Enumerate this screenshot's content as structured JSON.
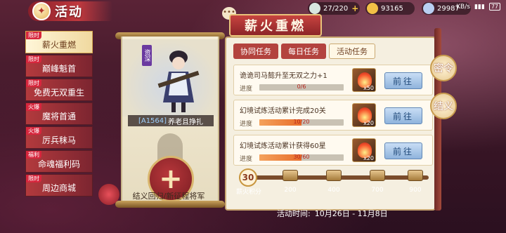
{
  "header": {
    "title": "活动",
    "resources": [
      {
        "name": "stamina",
        "value": "27/220",
        "color": "#d8e6e0"
      },
      {
        "name": "gold",
        "value": "93165",
        "color": "#f2c046"
      },
      {
        "name": "gem",
        "value": "29987",
        "color": "#b9cff2"
      }
    ],
    "status": {
      "net": "KB/s",
      "battery": "77"
    }
  },
  "menu": {
    "items": [
      {
        "tag": "限时",
        "label": "薪火重燃",
        "active": true
      },
      {
        "tag": "限时",
        "label": "巅峰魁首"
      },
      {
        "tag": "限时",
        "label": "免费无双重生"
      },
      {
        "tag": "火爆",
        "label": "魔将首通"
      },
      {
        "tag": "火爆",
        "label": "厉兵秣马"
      },
      {
        "tag": "福利",
        "label": "命魂福利码"
      },
      {
        "tag": "限时",
        "label": "周边商城"
      }
    ]
  },
  "scroll": {
    "rank": "资深",
    "hero_id": "[A1564]",
    "hero_name": "养老且挣扎",
    "caption": "结义回归/新征程将军"
  },
  "panel": {
    "title": "薪火重燃",
    "tabs": [
      "协同任务",
      "每日任务",
      "活动任务"
    ],
    "active_tab": 2,
    "progress_label": "进度",
    "go_label": "前往",
    "tasks": [
      {
        "title": "诡诡司马懿升至无双之力+1",
        "progress": "0/6",
        "fill": 0.0,
        "reward_count": "x50"
      },
      {
        "title": "幻境试炼活动累计完成20关",
        "progress": "10/20",
        "fill": 0.5,
        "reward_count": "x20"
      },
      {
        "title": "幻境试炼活动累计获得60星",
        "progress": "30/60",
        "fill": 0.5,
        "reward_count": "x20"
      }
    ]
  },
  "points": {
    "value": "30",
    "label": "薪火积分",
    "milestones": [
      "200",
      "400",
      "700",
      "900"
    ]
  },
  "side": {
    "top": "密令",
    "bottom": "结义"
  },
  "time": {
    "label": "活动时间:",
    "range": "10月26日 - 11月8日"
  }
}
